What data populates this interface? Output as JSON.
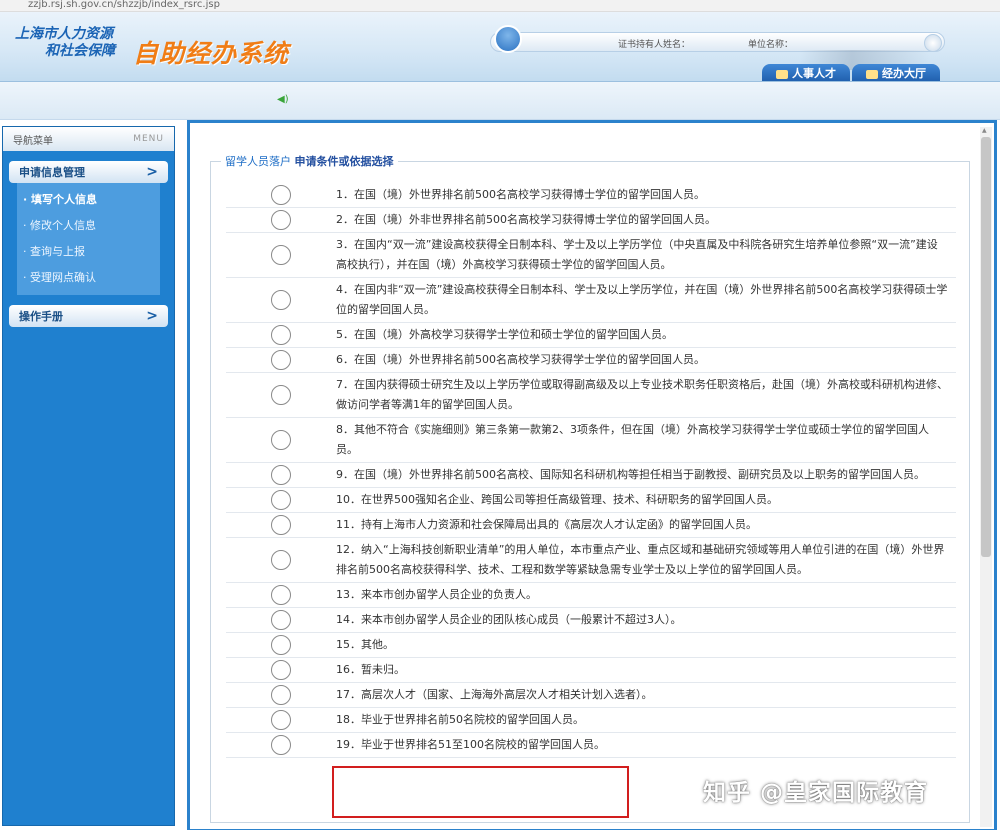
{
  "browser": {
    "url": "zzjb.rsj.sh.gov.cn/shzzjb/index_rsrc.jsp"
  },
  "header": {
    "org_line1": "上海市人力资源",
    "org_line2": "和社会保障",
    "system_title": "自助经办系统",
    "holder_label": "证书持有人姓名：",
    "unit_label": "单位名称：",
    "tabs": [
      {
        "label": "人事人才",
        "icon": "person-card-icon"
      },
      {
        "label": "经办大厅",
        "icon": "hall-icon"
      }
    ]
  },
  "sidebar": {
    "title": "导航菜单",
    "title_en": "MENU",
    "menus": [
      {
        "label": "申请信息管理",
        "items": [
          "填写个人信息",
          "修改个人信息",
          "查询与上报",
          "受理网点确认"
        ]
      },
      {
        "label": "操作手册",
        "items": []
      }
    ]
  },
  "main": {
    "legend_part1": "留学人员落户",
    "legend_part2": "申请条件或依据选择",
    "options": [
      "1．在国（境）外世界排名前500名高校学习获得博士学位的留学回国人员。",
      "2．在国（境）外非世界排名前500名高校学习获得博士学位的留学回国人员。",
      "3．在国内“双一流”建设高校获得全日制本科、学士及以上学历学位（中央直属及中科院各研究生培养单位参照“双一流”建设高校执行），并在国（境）外高校学习获得硕士学位的留学回国人员。",
      "4．在国内非“双一流”建设高校获得全日制本科、学士及以上学历学位，并在国（境）外世界排名前500名高校学习获得硕士学位的留学回国人员。",
      "5．在国（境）外高校学习获得学士学位和硕士学位的留学回国人员。",
      "6．在国（境）外世界排名前500名高校学习获得学士学位的留学回国人员。",
      "7．在国内获得硕士研究生及以上学历学位或取得副高级及以上专业技术职务任职资格后，赴国（境）外高校或科研机构进修、做访问学者等满1年的留学回国人员。",
      "8．其他不符合《实施细则》第三条第一款第2、3项条件，但在国（境）外高校学习获得学士学位或硕士学位的留学回国人员。",
      "9．在国（境）外世界排名前500名高校、国际知名科研机构等担任相当于副教授、副研究员及以上职务的留学回国人员。",
      "10．在世界500强知名企业、跨国公司等担任高级管理、技术、科研职务的留学回国人员。",
      "11．持有上海市人力资源和社会保障局出具的《高层次人才认定函》的留学回国人员。",
      "12．纳入“上海科技创新职业清单”的用人单位，本市重点产业、重点区域和基础研究领域等用人单位引进的在国（境）外世界排名前500名高校获得科学、技术、工程和数学等紧缺急需专业学士及以上学位的留学回国人员。",
      "13．来本市创办留学人员企业的负责人。",
      "14．来本市创办留学人员企业的团队核心成员（一般累计不超过3人）。",
      "15．其他。",
      "16．暂未归。",
      "17．高层次人才（国家、上海海外高层次人才相关计划入选者）。",
      "18．毕业于世界排名前50名院校的留学回国人员。",
      "19．毕业于世界排名51至100名院校的留学回国人员。"
    ]
  },
  "watermark": "知乎 @皇家国际教育",
  "colors": {
    "accent": "#2b82cc",
    "sidebar": "#1f80cf",
    "title_orange": "#f07d16",
    "highlight": "#d21e1e"
  }
}
